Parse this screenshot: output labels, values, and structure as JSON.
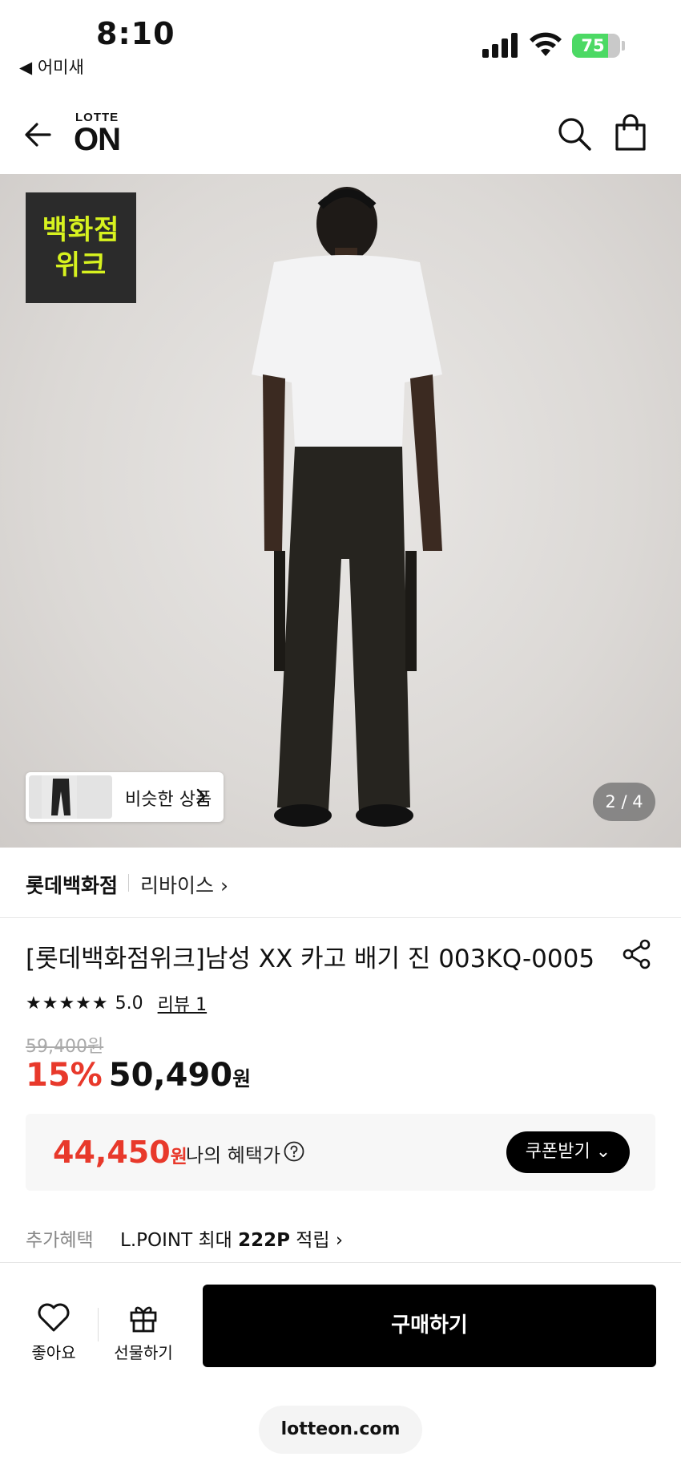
{
  "status": {
    "time": "8:10",
    "back_app": "◀ 어미새",
    "battery": "75",
    "battery_level": 0.75
  },
  "header": {
    "logo_small": "LOTTE",
    "logo_big": "ON"
  },
  "hero": {
    "badge_line1": "백화점",
    "badge_line2": "위크",
    "similar_label": "비슷한 상품",
    "counter": "2 / 4"
  },
  "product": {
    "store": "롯데백화점",
    "brand": "리바이스 ›",
    "title": "[롯데백화점위크]남성 XX 카고 배기 진 003KQ-0005",
    "stars": "★★★★★",
    "score": "5.0",
    "reviews": "리뷰 1",
    "original_price": "59,400원",
    "discount": "15%",
    "price": "50,490",
    "won": "원"
  },
  "benefit": {
    "price": "44,450",
    "won": "원",
    "label": "나의 혜택가",
    "coupon": "쿠폰받기 ⌄"
  },
  "extra": {
    "key": "추가혜택",
    "value_prefix": "L.POINT 최대 ",
    "value_bold": "222P",
    "value_suffix": " 적립 ›"
  },
  "bottom": {
    "like": "좋아요",
    "gift": "선물하기",
    "buy": "구매하기",
    "url": "lotteon.com"
  }
}
